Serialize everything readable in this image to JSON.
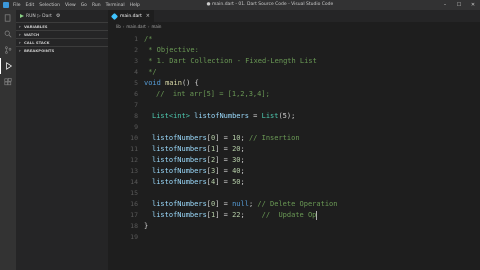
{
  "titlebar": {
    "menus": [
      "File",
      "Edit",
      "Selection",
      "View",
      "Go",
      "Run",
      "Terminal",
      "Help"
    ],
    "window_title": "● main.dart - 01. Dart Source Code - Visual Studio Code"
  },
  "debug": {
    "config": "RUN  ▷  Dart"
  },
  "sidebar": {
    "sections": [
      "VARIABLES",
      "WATCH",
      "CALL STACK",
      "BREAKPOINTS"
    ]
  },
  "tab": {
    "label": "main.dart"
  },
  "breadcrumb": [
    "lib",
    "main.dart",
    "main"
  ],
  "code": {
    "line_numbers": [
      "1",
      "2",
      "3",
      "4",
      "5",
      "6",
      "7",
      "8",
      "9",
      "10",
      "11",
      "12",
      "13",
      "14",
      "15",
      "16",
      "17",
      "18",
      "19"
    ],
    "l1": "/*",
    "l2": " * Objective:",
    "l3": " * 1. Dart Collection - Fixed-Length List",
    "l4": " */",
    "l5_kw": "void",
    "l5_fn": "main",
    "l5_rest": "() {",
    "l6": "//  int arr[5] = [1,2,3,4];",
    "l8_type": "List<int>",
    "l8_var": "listofNumbers",
    "l8_rest": " = ",
    "l8_fn": "List",
    "l8_end": "(5);",
    "assign": [
      {
        "idx": "0",
        "val": "10",
        "comment": "// Insertion"
      },
      {
        "idx": "1",
        "val": "20",
        "comment": ""
      },
      {
        "idx": "2",
        "val": "30",
        "comment": ""
      },
      {
        "idx": "3",
        "val": "40",
        "comment": ""
      },
      {
        "idx": "4",
        "val": "50",
        "comment": ""
      }
    ],
    "l16_val": "null",
    "l16_comment": "// Delete Operation",
    "l17_val": "22",
    "l17_comment": "//  Update Op",
    "l18": "}",
    "var_name": "listofNumbers"
  }
}
